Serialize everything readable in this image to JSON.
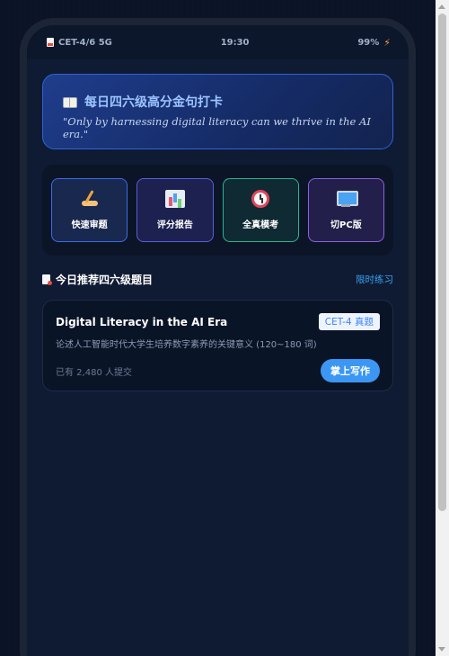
{
  "status_bar": {
    "carrier": "CET-4/6 5G",
    "time": "19:30",
    "battery": "99%"
  },
  "daily_quote": {
    "title": "每日四六级高分金句打卡",
    "quote": "\"Only by harnessing digital literacy can we thrive in the AI era.\""
  },
  "tools": [
    {
      "label": "快速审题",
      "icon": "writing-hand-icon"
    },
    {
      "label": "评分报告",
      "icon": "bar-chart-icon"
    },
    {
      "label": "全真模考",
      "icon": "alarm-clock-icon"
    },
    {
      "label": "切PC版",
      "icon": "desktop-monitor-icon"
    }
  ],
  "recommend": {
    "title": "今日推荐四六级题目",
    "link": "限时练习"
  },
  "topic": {
    "title": "Digital Literacy in the AI Era",
    "tag": "CET-4 真题",
    "description": "论述人工智能时代大学生培养数字素养的关键意义 (120~180 词)",
    "submitted": "已有 2,480 人提交",
    "action": "掌上写作"
  },
  "colors": {
    "accent": "#3b97f3",
    "link": "#38a3f0",
    "quote_border": "#2f62d6"
  }
}
